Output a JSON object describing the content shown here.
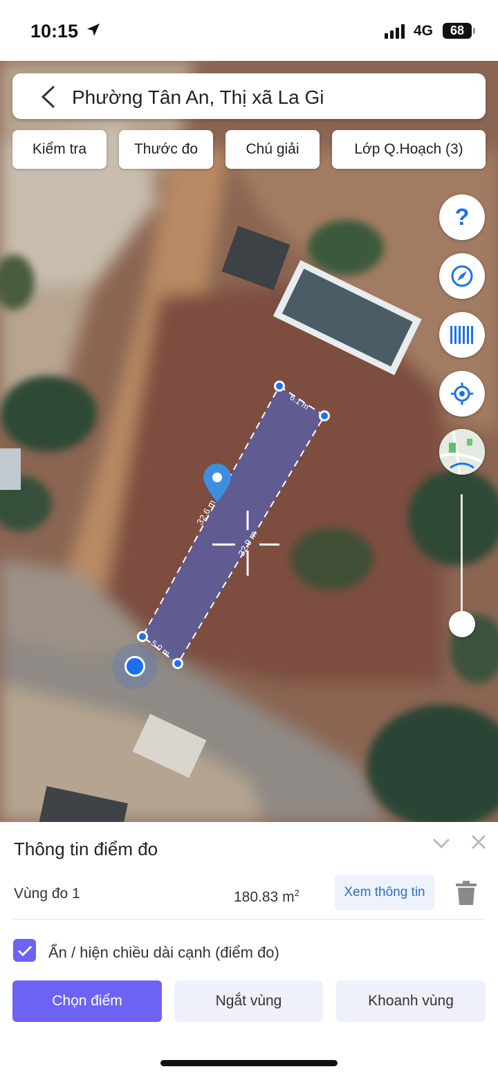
{
  "status_bar": {
    "time": "10:15",
    "network": "4G",
    "battery": "68"
  },
  "header": {
    "title": "Phường Tân An, Thị xã La Gi"
  },
  "toolbar": {
    "chips": [
      {
        "label": "Kiểm tra"
      },
      {
        "label": "Thước đo"
      },
      {
        "label": "Chú giải"
      },
      {
        "label": "Lớp Q.Hoạch (3)"
      }
    ]
  },
  "map": {
    "measurements": {
      "top_edge": "6.1 m",
      "left_edge": "32.6 m",
      "right_edge": "32.9 m",
      "bottom_edge": "5.0 m"
    },
    "fabs": [
      {
        "icon": "help-icon",
        "label": "?"
      },
      {
        "icon": "compass-icon"
      },
      {
        "icon": "barcode-icon"
      },
      {
        "icon": "locate-icon"
      },
      {
        "icon": "map-layer-icon"
      }
    ],
    "colors": {
      "polygon_fill": "#5b5ea0",
      "vertex": "#1e6ff0",
      "pin": "#3e8ee0"
    }
  },
  "panel": {
    "title": "Thông tin điểm đo",
    "area_label": "Vùng đo 1",
    "area_value": "180.83 m",
    "area_unit_exp": "2",
    "view_info_button": "Xem thông tin",
    "toggle_label": "Ẩn / hiện chiều dài cạnh (điểm đo)",
    "toggle_checked": true,
    "buttons": {
      "select_point": "Chọn điểm",
      "break_zone": "Ngắt vùng",
      "enclose_zone": "Khoanh vùng"
    },
    "colors": {
      "accent": "#6c63f4",
      "secondary_bg": "#eef1f9",
      "link": "#2d6fc9"
    }
  }
}
